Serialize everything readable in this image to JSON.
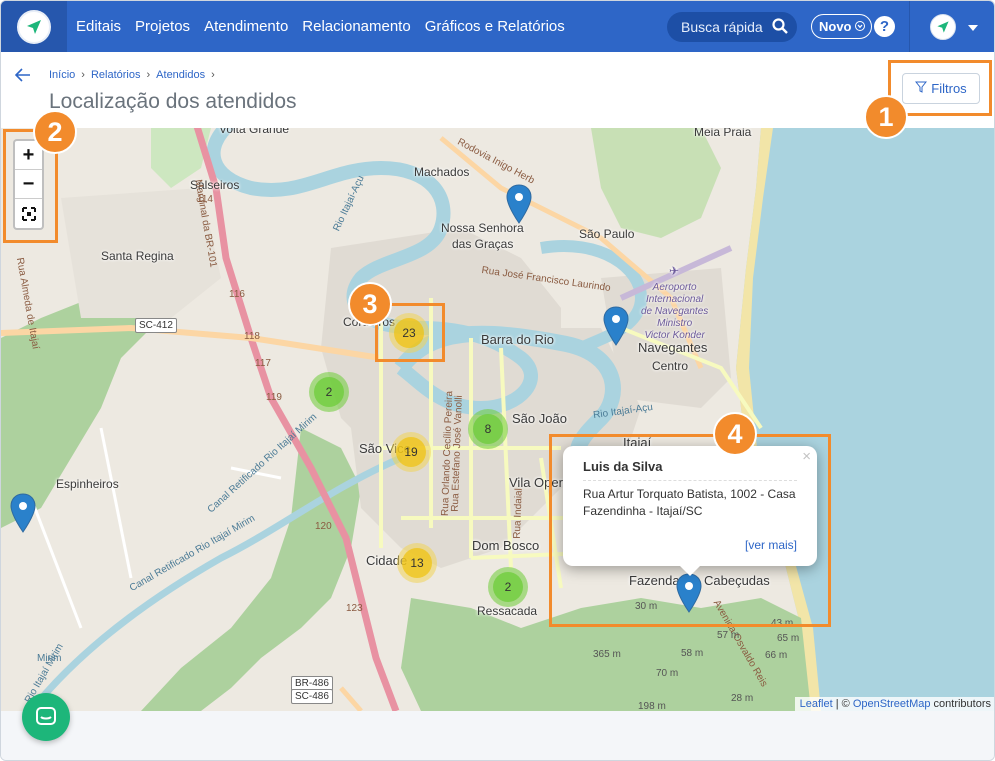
{
  "nav": {
    "items": [
      "Editais",
      "Projetos",
      "Atendimento",
      "Relacionamento",
      "Gráficos e Relatórios"
    ],
    "search_label": "Busca rápida",
    "novo_label": "Novo",
    "help_label": "?"
  },
  "header": {
    "breadcrumbs": [
      "Início",
      "Relatórios",
      "Atendidos"
    ],
    "title": "Localização dos atendidos",
    "filter_label": "Filtros"
  },
  "map": {
    "places": {
      "volta_grande": "Volta Grande",
      "machados": "Machados",
      "meia_praia": "Meia Praia",
      "salseiros": "Salseiros",
      "nossa_senhora": "Nossa Senhora",
      "das_gracas": "das Graças",
      "sao_paulo": "São Paulo",
      "santa_regina": "Santa Regina",
      "cordeiros": "Cordeiros",
      "barra_do_rio": "Barra do Rio",
      "navegantes": "Navegantes",
      "centro": "Centro",
      "sao_joao": "São João",
      "sao_vicente": "São Vice",
      "itajai": "Itajaí",
      "vila_operaria": "Vila Opera",
      "espinheiros": "Espinheiros",
      "dom_bosco": "Dom Bosco",
      "cidade_nova": "Cidade",
      "fazenda": "Fazenda",
      "cabecudas": "Cabeçudas",
      "ressacada": "Ressacada"
    },
    "airport": [
      "Aeroporto",
      "Internacional",
      "de Navegantes",
      "Ministro",
      "Victor Konder"
    ],
    "roads": {
      "sc412": "SC-412",
      "br486": "BR-486",
      "sc486": "SC-486",
      "rodovia": "Rodovia Inigo Herb",
      "rua_jose": "Rua José Francisco Laurindo",
      "canal1": "Canal Retificado Rio Itajaí Mirim",
      "canal2": "Canal Retificado Rio Itajaí Mirim",
      "rio_itajai": "Rio Itajaí-Açu",
      "marginal": "Marginal da BR-101",
      "rua_orlando": "Rua Orlando Cecílio Pereira",
      "rua_estefano": "Rua Estefano José Vanolli",
      "rua_indaial": "Rua Indaial",
      "avenida": "Avenida Osvaldo Reis",
      "rio_itajai_mirim_left": "Rio Itajaí Mirim",
      "rio_itajai_acu_right": "Rio Itajaí-Açu",
      "rua_almeda": "Rua Almeda de Itajaí"
    },
    "km_markers": [
      "114",
      "116",
      "117",
      "118",
      "119",
      "120",
      "123",
      "Mirim"
    ],
    "elevations": [
      "30 m",
      "57 m",
      "365 m",
      "66 m",
      "198 m",
      "28 m",
      "43 m",
      "65 m",
      "70 m",
      "58 m"
    ],
    "clusters": [
      {
        "count": "23",
        "color": "yellow"
      },
      {
        "count": "2",
        "color": "green"
      },
      {
        "count": "8",
        "color": "green"
      },
      {
        "count": "19",
        "color": "yellow"
      },
      {
        "count": "13",
        "color": "yellow"
      },
      {
        "count": "2",
        "color": "green"
      }
    ],
    "zoom": {
      "in": "+",
      "out": "−"
    },
    "popup": {
      "name": "Luis da Silva",
      "address": "Rua Artur Torquato Batista, 1002 - Casa Fazendinha - Itajaí/SC",
      "more": "[ver mais]",
      "close": "×"
    },
    "attribution": {
      "leaflet": "Leaflet",
      "sep": " | © ",
      "osm": "OpenStreetMap",
      "tail": " contributors"
    }
  },
  "annotations": [
    "1",
    "2",
    "3",
    "4"
  ],
  "colors": {
    "primary": "#2e66c7",
    "annotation": "#f28b2c",
    "cluster_yellow": "#f0c20c",
    "cluster_green": "#6ecc39",
    "marker": "#2a81cb"
  }
}
